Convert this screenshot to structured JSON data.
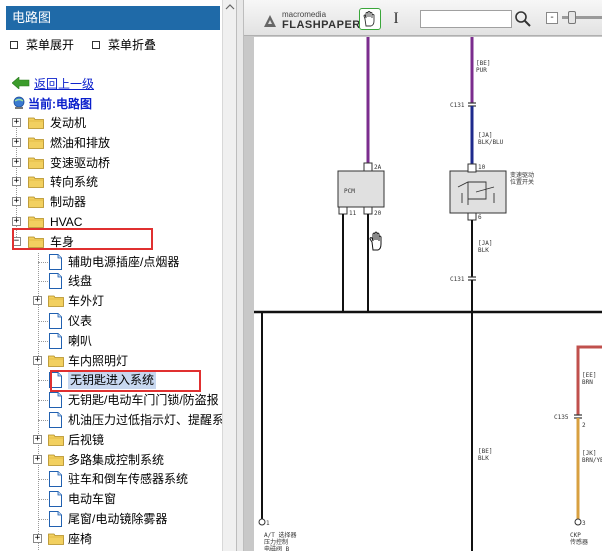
{
  "left_panel": {
    "title": "电路图",
    "menu_expand": "菜单展开",
    "menu_collapse": "菜单折叠",
    "back": "返回上一级",
    "current": "当前:电路图"
  },
  "tree": {
    "top": [
      {
        "label": "发动机"
      },
      {
        "label": "燃油和排放"
      },
      {
        "label": "变速驱动桥"
      },
      {
        "label": "转向系统"
      },
      {
        "label": "制动器"
      },
      {
        "label": "HVAC"
      },
      {
        "label": "车身"
      }
    ],
    "body_children": [
      {
        "label": "辅助电源插座/点烟器",
        "type": "doc"
      },
      {
        "label": "线盘",
        "type": "doc"
      },
      {
        "label": "车外灯",
        "type": "folder"
      },
      {
        "label": "仪表",
        "type": "doc"
      },
      {
        "label": "喇叭",
        "type": "doc"
      },
      {
        "label": "车内照明灯",
        "type": "folder"
      },
      {
        "label": "无钥匙进入系统",
        "type": "doc"
      },
      {
        "label": "无钥匙/电动车门门锁/防盗报",
        "type": "doc"
      },
      {
        "label": "机油压力过低指示灯、提醒系",
        "type": "doc"
      },
      {
        "label": "后视镜",
        "type": "folder"
      },
      {
        "label": "多路集成控制系统",
        "type": "folder"
      },
      {
        "label": "驻车和倒车传感器系统",
        "type": "doc"
      },
      {
        "label": "电动车窗",
        "type": "doc"
      },
      {
        "label": "尾窗/电动镜除雾器",
        "type": "doc"
      },
      {
        "label": "座椅",
        "type": "folder"
      }
    ]
  },
  "viewer": {
    "brand_top": "macromedia",
    "brand_bottom": "FLASHPAPER",
    "text_tool_glyph": "I",
    "search_value": "",
    "zoom_minus": "-"
  },
  "schematic": {
    "wire_top_left": "",
    "wire_top_right_color": "[BE]\nPUR",
    "c131_a": "C131",
    "c131_b": "C131",
    "c135": "C135",
    "pcm": "PCM",
    "pcm_pin_top": "2A",
    "pcm_pin_bl": "11",
    "pcm_pin_br": "20",
    "switch_label": "变速驱动\n位置开关",
    "switch_pin_top": "10",
    "switch_pin_bottom": "6",
    "wire_mid_right": "[JA]\nBLK/BLU",
    "wire_below_switch": "[JA]\nBLK",
    "wire_lower_mid": "[BE]\nBLK",
    "wire_right_top": "[EE]\nBRN",
    "wire_right_bottom": "[JK]\nBRN/YEL",
    "bottom_left_label": "A/T 选择器\n压力控制\n电磁阀 B",
    "bottom_right_label": "CKP\n传感器",
    "pin_bl": "1",
    "pin_br": "2",
    "pin_r2": "2",
    "pin_r3": "3"
  },
  "colors": {
    "title_bar": "#1f6aa8",
    "link": "#0a1fcc",
    "highlight_box": "#e03030",
    "wire_purple": "#7b2d8e",
    "wire_blue": "#1e2a8c",
    "wire_red": "#c0504d",
    "wire_orange": "#d8a040"
  }
}
